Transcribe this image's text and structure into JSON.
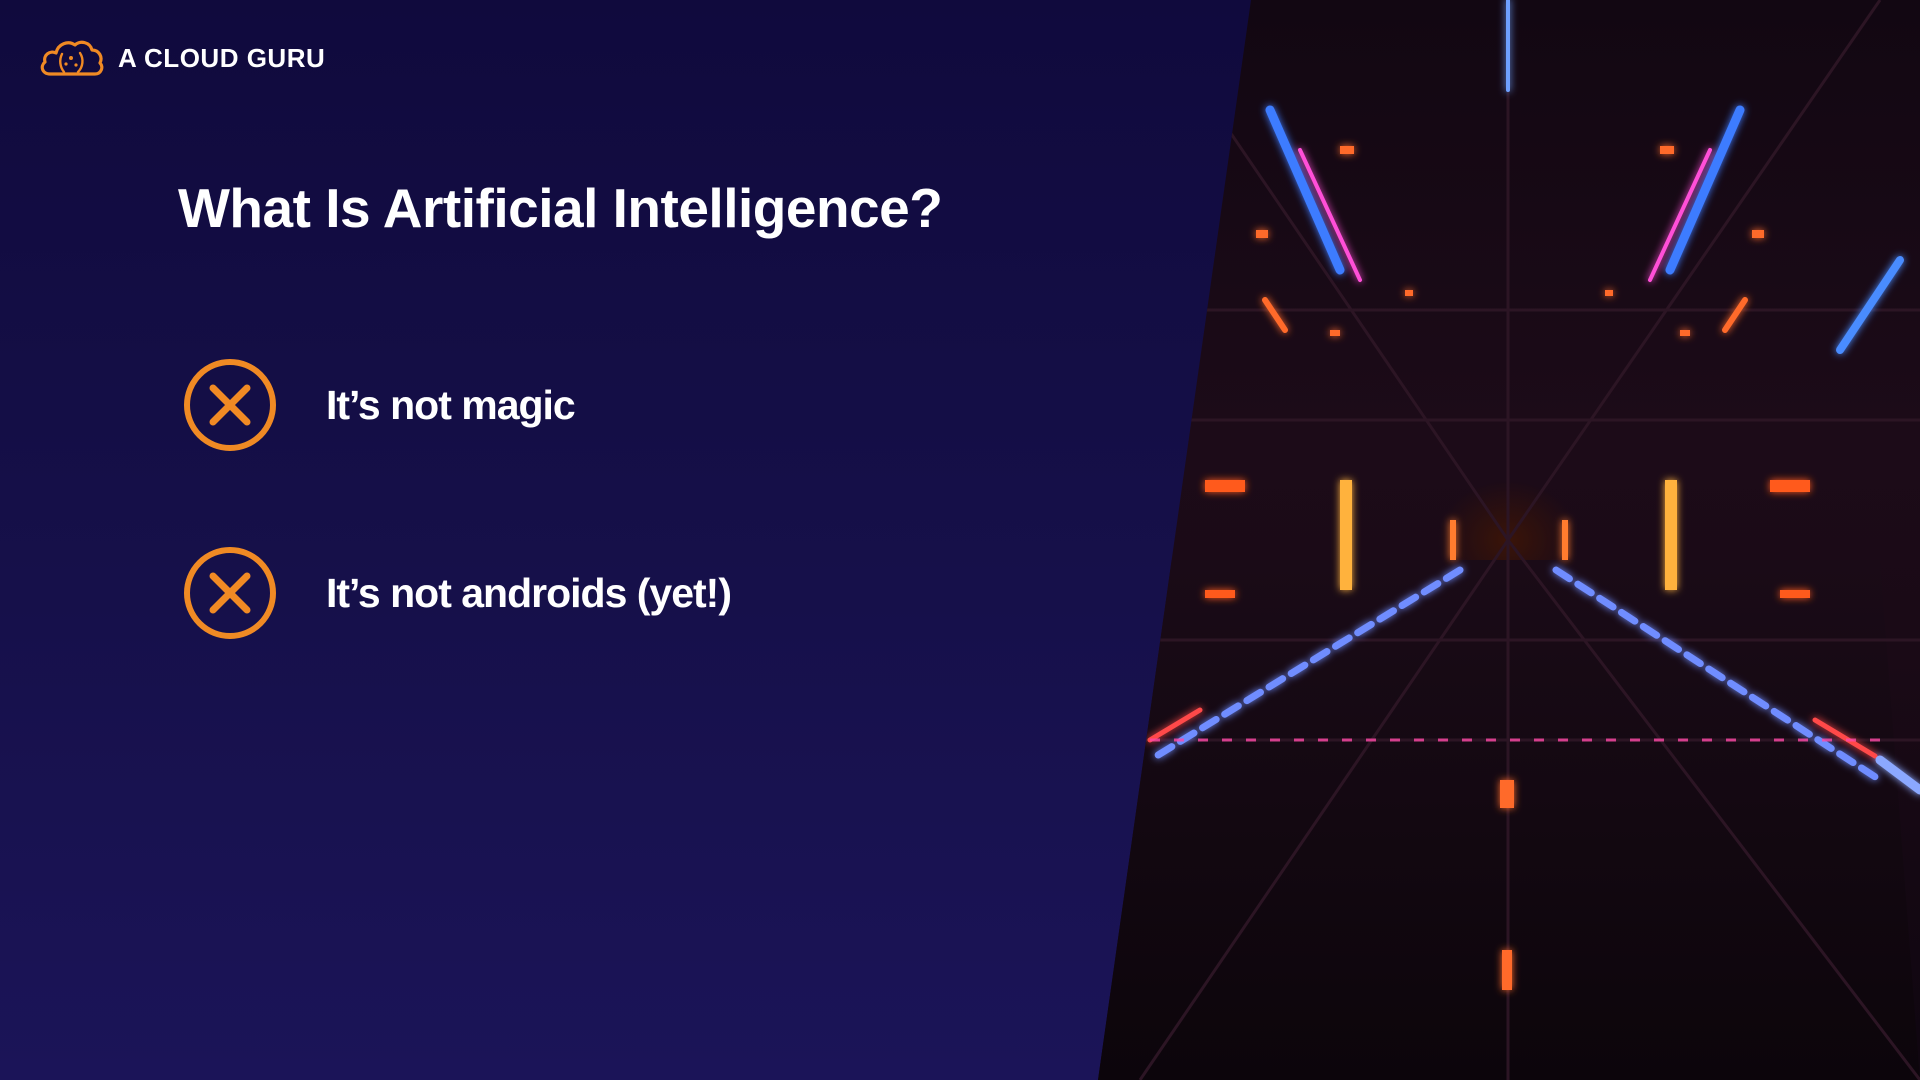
{
  "brand": {
    "name": "A CLOUD GURU",
    "logo_icon": "cloud-logo-icon",
    "accent_color": "#f08a24"
  },
  "slide": {
    "title": "What Is Artificial Intelligence?",
    "background_color": "#120c40",
    "bullets": [
      {
        "icon": "x-circle-icon",
        "text": "It’s not magic"
      },
      {
        "icon": "x-circle-icon",
        "text": "It’s not androids (yet!)"
      }
    ]
  },
  "image": {
    "description_icon": "neon-corridor-image"
  }
}
